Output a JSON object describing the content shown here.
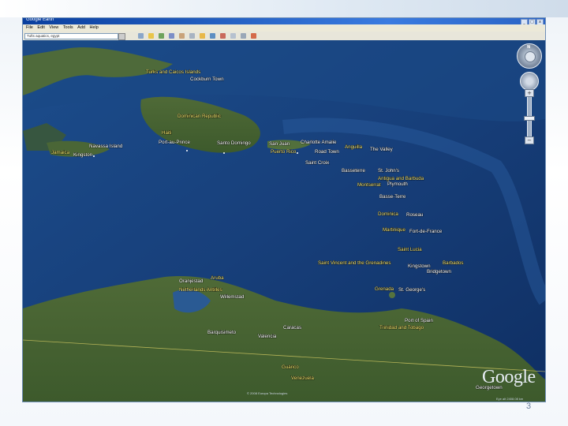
{
  "window": {
    "title": "Google Earth",
    "menu": [
      "File",
      "Edit",
      "View",
      "Tools",
      "Add",
      "Help"
    ],
    "search_value": "Tufts aquatics, egypt",
    "controls": {
      "minimize": "_",
      "maximize": "□",
      "close": "x"
    }
  },
  "map": {
    "labels": [
      {
        "id": "turks-caicos",
        "text": "Turks and Caicos Islands",
        "style": "y"
      },
      {
        "id": "cockburn-town",
        "text": "Cockburn Town",
        "style": "w"
      },
      {
        "id": "dominican-republic",
        "text": "Dominican Republic",
        "style": "y"
      },
      {
        "id": "haiti",
        "text": "Haiti",
        "style": "y"
      },
      {
        "id": "port-au-prince",
        "text": "Port-au-Prince",
        "style": "w"
      },
      {
        "id": "santo-domingo",
        "text": "Santo Domingo",
        "style": "w"
      },
      {
        "id": "navassa",
        "text": "Navassa Island",
        "style": "w"
      },
      {
        "id": "jamaica",
        "text": "Jamaica",
        "style": "y"
      },
      {
        "id": "kingston",
        "text": "Kingston",
        "style": "w"
      },
      {
        "id": "san-juan",
        "text": "San Juan",
        "style": "w"
      },
      {
        "id": "charlotte-amalie",
        "text": "Charlotte Amalie",
        "style": "w"
      },
      {
        "id": "anguilla",
        "text": "Anguilla",
        "style": "y"
      },
      {
        "id": "the-valley",
        "text": "The Valley",
        "style": "w"
      },
      {
        "id": "road-town",
        "text": "Road Town",
        "style": "w"
      },
      {
        "id": "puerto-rico",
        "text": "Puerto Rico",
        "style": "y"
      },
      {
        "id": "saint-croix",
        "text": "Saint Croix",
        "style": "w"
      },
      {
        "id": "basseterre",
        "text": "Basseterre",
        "style": "w"
      },
      {
        "id": "st-johns",
        "text": "St. John's",
        "style": "w"
      },
      {
        "id": "antigua-barbuda",
        "text": "Antigua and Barbuda",
        "style": "y"
      },
      {
        "id": "montserrat",
        "text": "Montserrat",
        "style": "y"
      },
      {
        "id": "plymouth",
        "text": "Plymouth",
        "style": "w"
      },
      {
        "id": "basse-terre",
        "text": "Basse-Terre",
        "style": "w"
      },
      {
        "id": "dominica",
        "text": "Dominica",
        "style": "y"
      },
      {
        "id": "roseau",
        "text": "Roseau",
        "style": "w"
      },
      {
        "id": "martinique",
        "text": "Martinique",
        "style": "y"
      },
      {
        "id": "fort-de-france",
        "text": "Fort-de-France",
        "style": "w"
      },
      {
        "id": "saint-lucia",
        "text": "Saint Lucia",
        "style": "y"
      },
      {
        "id": "svg",
        "text": "Saint Vincent and the Grenadines",
        "style": "y"
      },
      {
        "id": "kingstown",
        "text": "Kingstown",
        "style": "w"
      },
      {
        "id": "barbados",
        "text": "Barbados",
        "style": "y"
      },
      {
        "id": "bridgetown",
        "text": "Bridgetown",
        "style": "w"
      },
      {
        "id": "oranjestad",
        "text": "Oranjestad",
        "style": "w"
      },
      {
        "id": "aruba",
        "text": "Aruba",
        "style": "y"
      },
      {
        "id": "netherlands-antilles",
        "text": "Netherlands Antilles",
        "style": "y"
      },
      {
        "id": "willemstad",
        "text": "Willemstad",
        "style": "w"
      },
      {
        "id": "grenada",
        "text": "Grenada",
        "style": "y"
      },
      {
        "id": "st-georges",
        "text": "St. George's",
        "style": "w"
      },
      {
        "id": "port-of-spain",
        "text": "Port of Spain",
        "style": "w"
      },
      {
        "id": "trinidad-tobago",
        "text": "Trinidad and Tobago",
        "style": "y"
      },
      {
        "id": "barquisimeto",
        "text": "Barquisimeto",
        "style": "w"
      },
      {
        "id": "valencia",
        "text": "Valencia",
        "style": "w"
      },
      {
        "id": "caracas",
        "text": "Caracas",
        "style": "w"
      },
      {
        "id": "guarico",
        "text": "Guárico",
        "style": "y"
      },
      {
        "id": "venezuela",
        "text": "Venezuela",
        "style": "y"
      },
      {
        "id": "georgetown",
        "text": "Georgetown",
        "style": "w"
      }
    ]
  },
  "nav": {
    "north": "N",
    "zoom_in": "+",
    "zoom_out": "−"
  },
  "branding": {
    "logo": "Google"
  },
  "attribution": "© 2008 Europa Technologies",
  "coords": "Eye alt 2408.08 km",
  "page_number": "3"
}
